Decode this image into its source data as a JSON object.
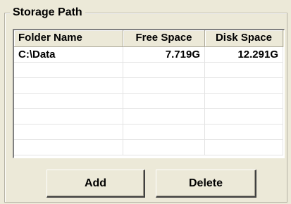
{
  "group": {
    "title": "Storage Path"
  },
  "table": {
    "columns": [
      "Folder Name",
      "Free Space",
      "Disk Space"
    ],
    "rows": [
      [
        "C:\\Data",
        "7.719G",
        "12.291G"
      ],
      [
        "",
        "",
        ""
      ],
      [
        "",
        "",
        ""
      ],
      [
        "",
        "",
        ""
      ],
      [
        "",
        "",
        ""
      ],
      [
        "",
        "",
        ""
      ],
      [
        "",
        "",
        ""
      ]
    ]
  },
  "buttons": {
    "add_label": "Add",
    "delete_label": "Delete"
  }
}
